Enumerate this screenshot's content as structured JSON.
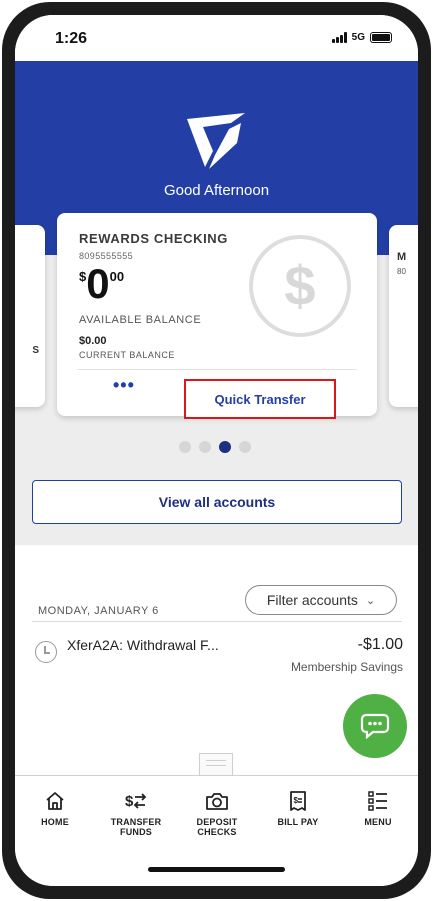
{
  "status_bar": {
    "time": "1:26",
    "network": "5G"
  },
  "header": {
    "greeting": "Good Afternoon"
  },
  "cards": {
    "left_peek": "S",
    "right_peek_a": "M",
    "right_peek_b": "80",
    "main": {
      "name": "REWARDS CHECKING",
      "number": "8095555555",
      "balance_symbol": "$",
      "balance_whole": "0",
      "balance_cents": "00",
      "available_label": "AVAILABLE BALANCE",
      "current_amount": "$0.00",
      "current_label": "CURRENT BALANCE",
      "more_label": "•••",
      "quick_transfer_label": "Quick Transfer"
    }
  },
  "pagination": {
    "count": 4,
    "active": 2
  },
  "view_all_label": "View all accounts",
  "transactions": {
    "filter_label": "Filter accounts",
    "date": "MONDAY, JANUARY 6",
    "items": [
      {
        "title": "XferA2A: Withdrawal F...",
        "amount": "-$1.00",
        "account": "Membership Savings"
      }
    ]
  },
  "nav": {
    "items": [
      {
        "label": "HOME",
        "icon": "home-icon"
      },
      {
        "label": "TRANSFER\nFUNDS",
        "icon": "transfer-icon"
      },
      {
        "label": "DEPOSIT\nCHECKS",
        "icon": "camera-icon"
      },
      {
        "label": "BILL PAY",
        "icon": "bill-icon"
      },
      {
        "label": "MENU",
        "icon": "menu-list-icon"
      }
    ]
  },
  "colors": {
    "brand_blue": "#233fa5",
    "dark_blue": "#1d2f80",
    "chat_green": "#4fb043",
    "highlight_red": "#e01515"
  }
}
